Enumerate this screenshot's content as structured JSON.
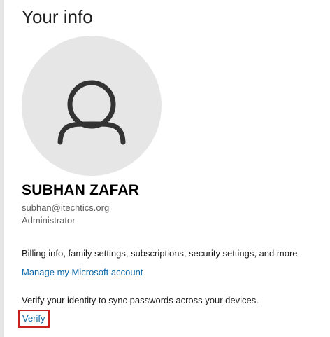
{
  "page": {
    "title": "Your info"
  },
  "avatar": {
    "icon": "person-icon",
    "background_color": "#e6e6e6",
    "icon_color": "#333333"
  },
  "user": {
    "name": "SUBHAN ZAFAR",
    "email": "subhan@itechtics.org",
    "role": "Administrator"
  },
  "account": {
    "description": "Billing info, family settings, subscriptions, security settings, and more",
    "manage_link_label": "Manage my Microsoft account"
  },
  "verify": {
    "description": "Verify your identity to sync passwords across your devices.",
    "link_label": "Verify",
    "highlight_color": "#c8201f"
  },
  "colors": {
    "link": "#0a67a8",
    "secondary_text": "#5a5a5a"
  }
}
